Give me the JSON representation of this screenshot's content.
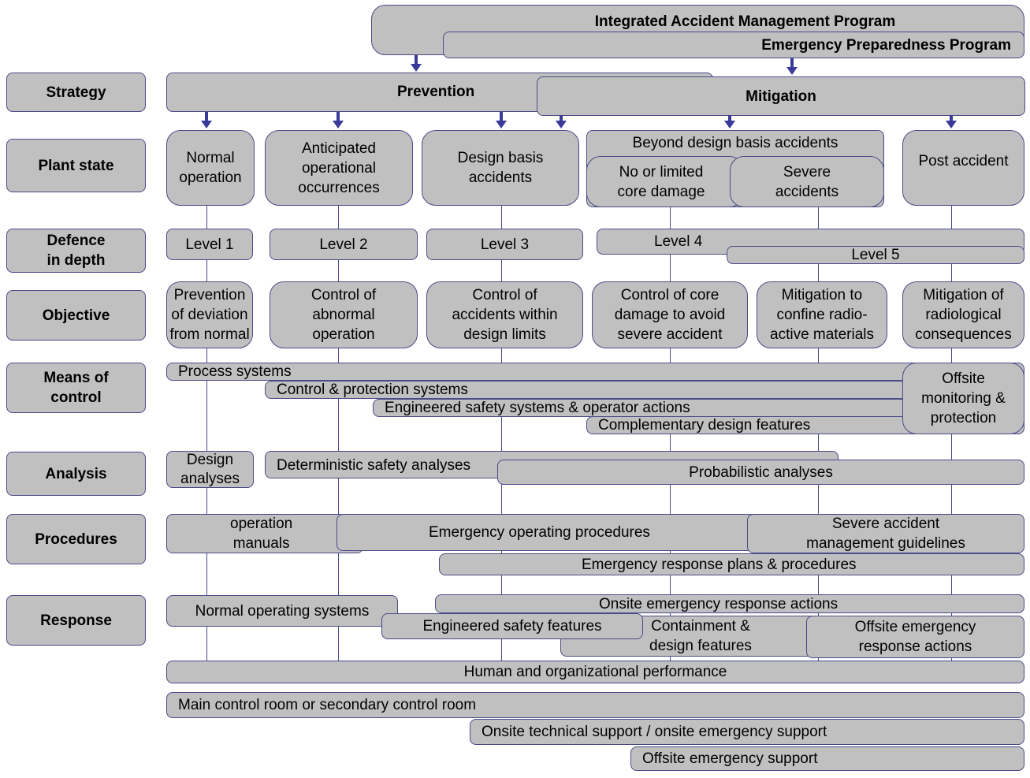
{
  "programs": {
    "integrated": "Integrated Accident Management Program",
    "emergency": "Emergency Preparedness Program"
  },
  "row_labels": {
    "strategy": "Strategy",
    "plant_state": "Plant state",
    "defence": "Defence\nin depth",
    "objective": "Objective",
    "means": "Means of\ncontrol",
    "analysis": "Analysis",
    "procedures": "Procedures",
    "response": "Response"
  },
  "strategy": {
    "prevention": "Prevention",
    "mitigation": "Mitigation"
  },
  "plant_state": {
    "normal": "Normal\noperation",
    "aoo": "Anticipated\noperational\noccurrences",
    "dba": "Design basis\naccidents",
    "bdba": "Beyond design basis accidents",
    "limited": "No or limited\ncore damage",
    "severe": "Severe\naccidents",
    "post": "Post accident"
  },
  "defence": {
    "l1": "Level 1",
    "l2": "Level 2",
    "l3": "Level 3",
    "l4": "Level 4",
    "l5": "Level 5"
  },
  "objective": {
    "o1": "Prevention\nof deviation\nfrom normal",
    "o2": "Control of\nabnormal\noperation",
    "o3": "Control of\naccidents within\ndesign limits",
    "o4": "Control of core\ndamage to avoid\nsevere accident",
    "o5": "Mitigation to\nconfine radio-\nactive materials",
    "o6": "Mitigation of\nradiological\nconsequences"
  },
  "means": {
    "process": "Process systems",
    "control": "Control & protection systems",
    "ess": "Engineered safety systems & operator actions",
    "cdf": "Complementary design features",
    "offsite": "Offsite\nmonitoring &\nprotection"
  },
  "analysis": {
    "design": "Design\nanalyses",
    "deterministic": "Deterministic safety analyses",
    "probabilistic": "Probabilistic analyses"
  },
  "procedures": {
    "manuals": "operation\nmanuals",
    "eop": "Emergency operating procedures",
    "samg": "Severe accident\nmanagement guidelines",
    "erp": "Emergency response plans & procedures"
  },
  "response": {
    "normal_sys": "Normal operating systems",
    "onsite_actions": "Onsite emergency response actions",
    "esf": "Engineered safety features",
    "containment": "Containment &\ndesign features",
    "offsite_actions": "Offsite emergency\nresponse actions",
    "human": "Human and organizational performance",
    "mcr": "Main control room or secondary control room",
    "onsite_support": "Onsite technical support  / onsite emergency support",
    "offsite_support": "Offsite emergency support"
  },
  "colors": {
    "box_fill": "#c0c0c0",
    "border": "#4a4a8a",
    "arrow": "#3a3a9a"
  }
}
